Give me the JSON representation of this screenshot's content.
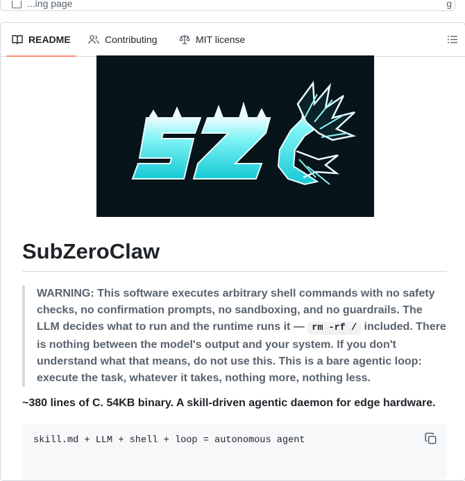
{
  "top_bar": {
    "left_text": "...ing page",
    "right_text": "g"
  },
  "tabs": [
    {
      "label": "README",
      "icon": "book-icon",
      "active": true
    },
    {
      "label": "Contributing",
      "icon": "people-icon",
      "active": false
    },
    {
      "label": "MIT license",
      "icon": "law-icon",
      "active": false
    }
  ],
  "toc_icon": "list-unordered-icon",
  "logo": {
    "text": "SZ",
    "description_icon": "subzeroclaw-logo"
  },
  "readme": {
    "title": "SubZeroClaw",
    "warning_before": "WARNING: This software executes arbitrary shell commands with no safety checks, no confirmation prompts, no sandboxing, and no guardrails. The LLM decides what to run and the runtime runs it — ",
    "warning_code": "rm -rf /",
    "warning_after": " included. There is nothing between the model's output and your system. If you don't understand what that means, do not use this. This is a bare agentic loop: execute the task, whatever it takes, nothing more, nothing less.",
    "tagline": "~380 lines of C. 54KB binary. A skill-driven agentic daemon for edge hardware.",
    "code_line": "skill.md + LLM + shell + loop = autonomous agent"
  },
  "colors": {
    "active_tab_underline": "#fd8c73",
    "logo_bg": "#071419",
    "logo_cyan": "#2ee6e6",
    "border": "#d1d9e0"
  }
}
